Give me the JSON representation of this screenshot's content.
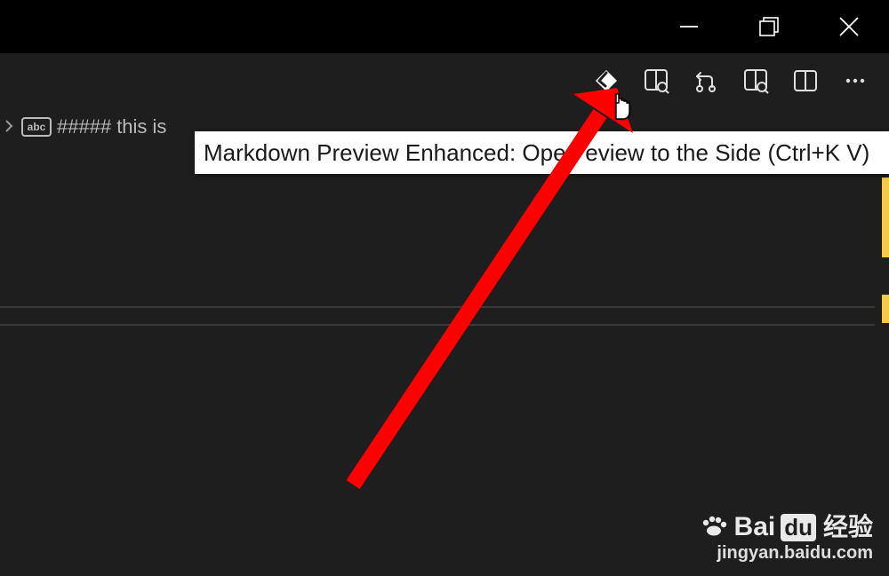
{
  "window": {
    "controls": {
      "minimize": "minimize",
      "maximize": "maximize",
      "close": "close"
    }
  },
  "toolbar_icons": {
    "extension": "extension-icon",
    "preview_side": "preview-side-icon",
    "compare": "compare-changes-icon",
    "preview": "open-preview-icon",
    "split": "split-editor-icon",
    "more": "more-actions-icon"
  },
  "breadcrumb": {
    "heading_marker": "#####",
    "badge": "abc",
    "text": "this is"
  },
  "tooltip": {
    "text": "Markdown Preview Enhanced: Open       eview to the Side (Ctrl+K V)"
  },
  "watermark": {
    "brand_left": "Bai",
    "brand_box": "du",
    "brand_right": "经验",
    "url": "jingyan.baidu.com"
  }
}
